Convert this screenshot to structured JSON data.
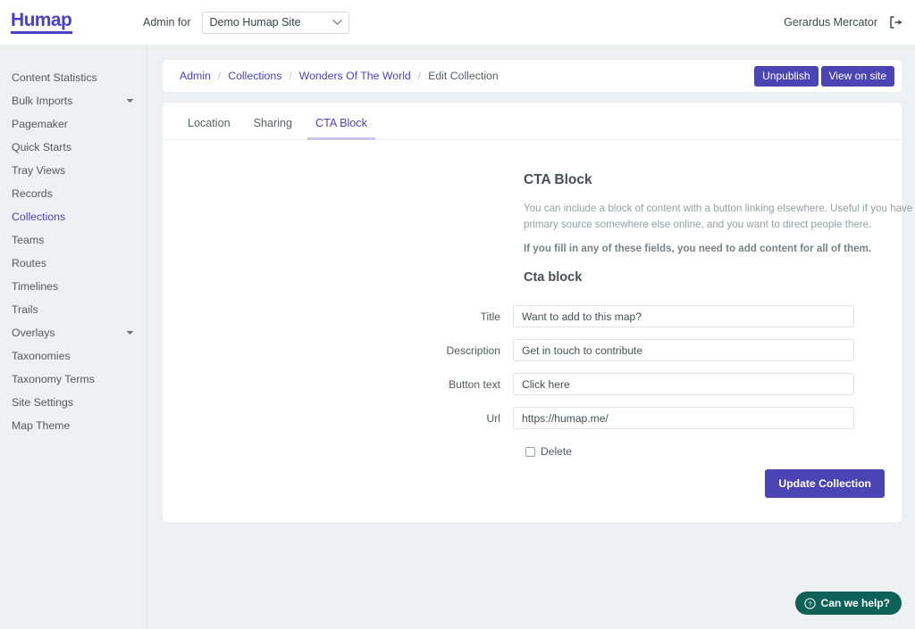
{
  "topbar": {
    "logo_text": "Humap",
    "logo_mark": "°",
    "admin_for_label": "Admin for",
    "site_selected": "Demo Humap Site",
    "site_options": [
      "Demo Humap Site"
    ],
    "user_name": "Gerardus Mercator",
    "logout_icon": "sign-out-icon",
    "caret_icon": "chevron-down-icon"
  },
  "sidebar": {
    "items": [
      {
        "label": "Content Statistics",
        "active": false,
        "expandable": false
      },
      {
        "label": "Bulk Imports",
        "active": false,
        "expandable": true
      },
      {
        "label": "Pagemaker",
        "active": false,
        "expandable": false
      },
      {
        "label": "Quick Starts",
        "active": false,
        "expandable": false
      },
      {
        "label": "Tray Views",
        "active": false,
        "expandable": false
      },
      {
        "label": "Records",
        "active": false,
        "expandable": false
      },
      {
        "label": "Collections",
        "active": true,
        "expandable": false
      },
      {
        "label": "Teams",
        "active": false,
        "expandable": false
      },
      {
        "label": "Routes",
        "active": false,
        "expandable": false
      },
      {
        "label": "Timelines",
        "active": false,
        "expandable": false
      },
      {
        "label": "Trails",
        "active": false,
        "expandable": false
      },
      {
        "label": "Overlays",
        "active": false,
        "expandable": true
      },
      {
        "label": "Taxonomies",
        "active": false,
        "expandable": false
      },
      {
        "label": "Taxonomy Terms",
        "active": false,
        "expandable": false
      },
      {
        "label": "Site Settings",
        "active": false,
        "expandable": false
      },
      {
        "label": "Map Theme",
        "active": false,
        "expandable": false
      }
    ]
  },
  "breadcrumb": {
    "items": [
      {
        "label": "Admin",
        "current": false
      },
      {
        "label": "Collections",
        "current": false
      },
      {
        "label": "Wonders Of The World",
        "current": false
      },
      {
        "label": "Edit Collection",
        "current": true
      }
    ],
    "separator": "/",
    "unpublish_label": "Unpublish",
    "view_on_site_label": "View on site"
  },
  "tabs": [
    {
      "label": "Location",
      "active": false
    },
    {
      "label": "Sharing",
      "active": false
    },
    {
      "label": "CTA Block",
      "active": true
    }
  ],
  "cta_block": {
    "heading": "CTA Block",
    "description": "You can include a block of content with a button linking elsewhere. Useful if you have a primary source somewhere else online, and you want to direct people there.",
    "warning": "If you fill in any of these fields, you need to add content for all of them.",
    "sub_heading": "Cta block",
    "fields": [
      {
        "label": "Title",
        "value": "Want to add to this map?",
        "name": "title"
      },
      {
        "label": "Description",
        "value": "Get in touch to contribute",
        "name": "description"
      },
      {
        "label": "Button text",
        "value": "Click here",
        "name": "button-text"
      },
      {
        "label": "Url",
        "value": "https://humap.me/",
        "name": "url"
      }
    ],
    "delete_label": "Delete",
    "delete_checked": false,
    "submit_label": "Update Collection"
  },
  "chat": {
    "label": "Can we help?",
    "icon": "question-circle-icon",
    "color": "#0d6156"
  },
  "colors": {
    "brand_purple": "#4a42c4",
    "button_purple": "#4a44b5",
    "page_background": "#eff0f2",
    "card_background": "#ffffff",
    "tab_underline": "#c9c6ea"
  }
}
